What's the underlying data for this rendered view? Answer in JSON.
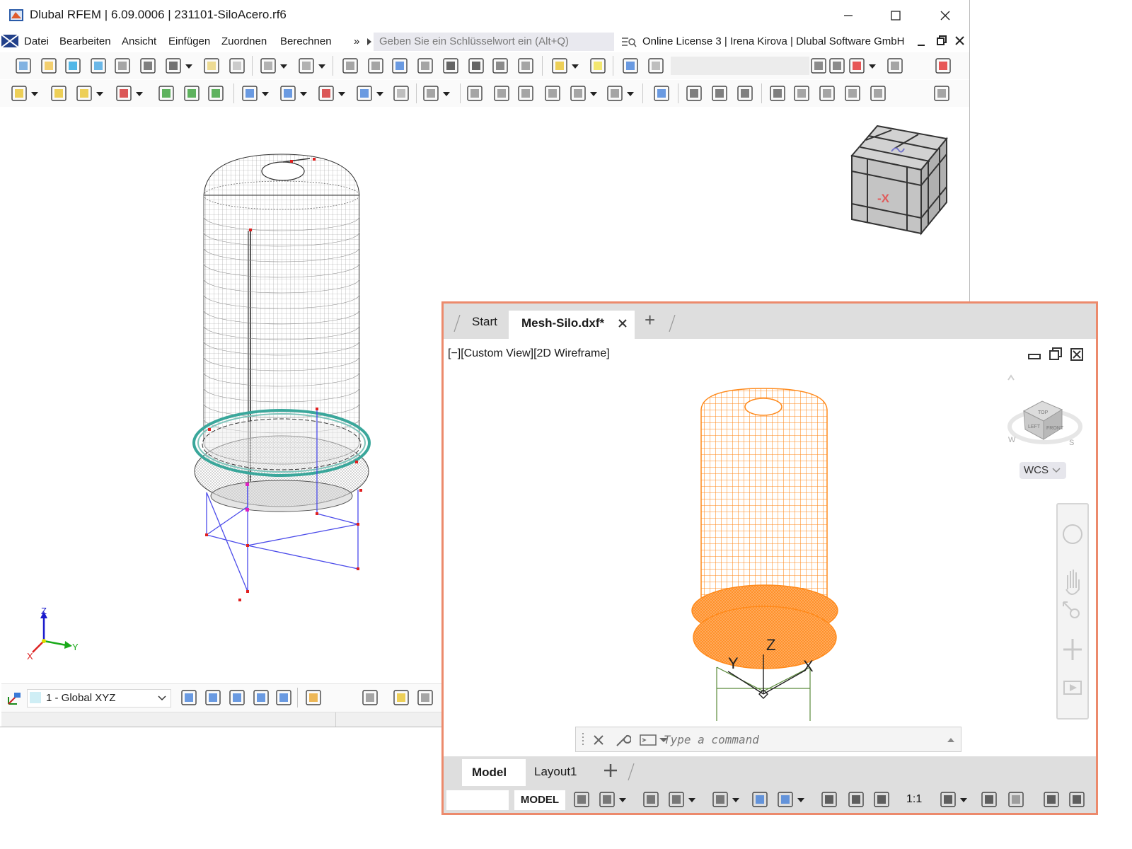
{
  "rfem": {
    "title": "Dlubal RFEM | 6.09.0006 | 231101-SiloAcero.rf6",
    "menu": [
      "Datei",
      "Bearbeiten",
      "Ansicht",
      "Einfügen",
      "Zuordnen",
      "Berechnen"
    ],
    "more": "»",
    "search_placeholder": "Geben Sie ein Schlüsselwort ein (Alt+Q)",
    "license": "Online License 3 | Irena Kirova | Dlubal Software GmbH",
    "coord_system": "1 - Global XYZ",
    "viewcube_label": "-X",
    "axis_labels": {
      "x": "X",
      "y": "Y",
      "z": "Z"
    },
    "colors": {
      "members": "#4b4bea",
      "nodes": "#e02020",
      "ring": "#3aa79b"
    }
  },
  "cad": {
    "tabs": {
      "start": "Start",
      "active": "Mesh-Silo.dxf*",
      "add": "+"
    },
    "view_label": "[−][Custom View][2D Wireframe]",
    "wcs": "WCS",
    "viewcube_faces": {
      "top": "TOP",
      "left": "LEFT",
      "front": "FRONT"
    },
    "compass": {
      "w": "W",
      "s": "S"
    },
    "axis_labels": {
      "x": "X",
      "y": "Y",
      "z": "Z"
    },
    "command_placeholder": "Type a command",
    "layout_tabs": [
      "Model",
      "Layout1"
    ],
    "status_model": "MODEL",
    "scale": "1:1",
    "colors": {
      "mesh": "#ff8a1c",
      "frame": "#5a8a3a",
      "border": "#ec8a6c"
    }
  }
}
